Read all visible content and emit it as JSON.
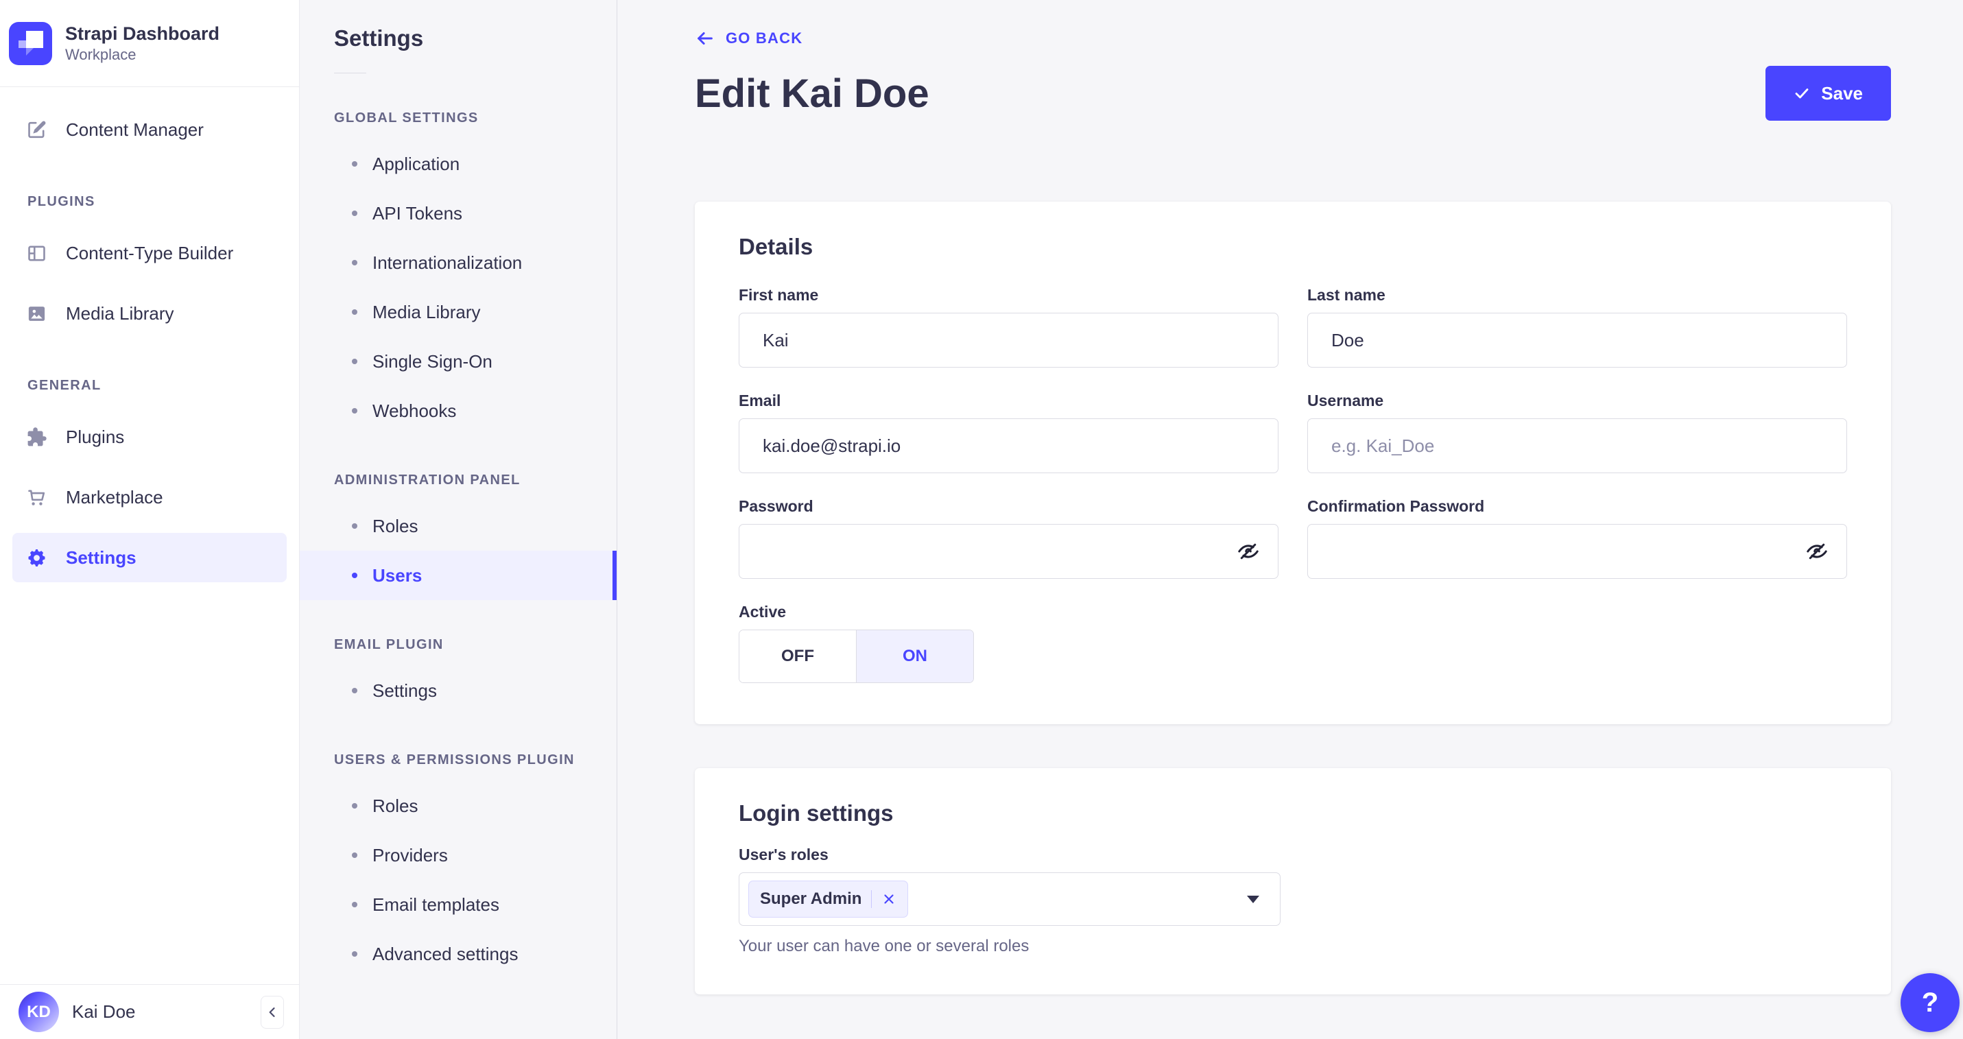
{
  "app": {
    "brand_title": "Strapi Dashboard",
    "brand_subtitle": "Workplace"
  },
  "colors": {
    "primary": "#4945ff",
    "primary_light": "#f0f0ff",
    "text": "#32324d",
    "muted": "#666687",
    "icon": "#8e8ea9",
    "border": "#dcdce4",
    "surface": "#ffffff",
    "background": "#f6f6f9"
  },
  "icons": {
    "logo": "strapi-logo",
    "content_manager": "feather-icon",
    "content_type_builder": "layout-icon",
    "media_library": "picture-icon",
    "plugins": "puzzle-icon",
    "marketplace": "cart-icon",
    "settings": "gear-icon",
    "collapse": "chevron-left-icon",
    "go_back": "arrow-left-icon",
    "save": "check-icon",
    "password_visibility": "eye-slash-icon",
    "roles_select": "caret-down-icon",
    "tag_remove": "x-icon",
    "help": "question-icon"
  },
  "nav": {
    "content_manager": "Content Manager",
    "sections": [
      {
        "label": "PLUGINS",
        "items": [
          "Content-Type Builder",
          "Media Library"
        ]
      },
      {
        "label": "GENERAL",
        "items": [
          "Plugins",
          "Marketplace",
          "Settings"
        ]
      }
    ],
    "active_item": "Settings",
    "user": {
      "initials": "KD",
      "name": "Kai Doe"
    }
  },
  "settings_nav": {
    "title": "Settings",
    "sections": [
      {
        "label": "GLOBAL SETTINGS",
        "items": [
          "Application",
          "API Tokens",
          "Internationalization",
          "Media Library",
          "Single Sign-On",
          "Webhooks"
        ]
      },
      {
        "label": "ADMINISTRATION PANEL",
        "items": [
          "Roles",
          "Users"
        ],
        "active_item": "Users"
      },
      {
        "label": "EMAIL PLUGIN",
        "items": [
          "Settings"
        ]
      },
      {
        "label": "USERS & PERMISSIONS PLUGIN",
        "items": [
          "Roles",
          "Providers",
          "Email templates",
          "Advanced settings"
        ]
      }
    ]
  },
  "header": {
    "go_back": "GO BACK",
    "title": "Edit Kai Doe",
    "save": "Save"
  },
  "details": {
    "heading": "Details",
    "first_name": {
      "label": "First name",
      "value": "Kai"
    },
    "last_name": {
      "label": "Last name",
      "value": "Doe"
    },
    "email": {
      "label": "Email",
      "value": "kai.doe@strapi.io"
    },
    "username": {
      "label": "Username",
      "placeholder": "e.g. Kai_Doe"
    },
    "password": {
      "label": "Password",
      "value": ""
    },
    "confirmation_password": {
      "label": "Confirmation Password",
      "value": ""
    },
    "active": {
      "label": "Active",
      "off": "OFF",
      "on": "ON",
      "selected": "ON"
    }
  },
  "login_settings": {
    "heading": "Login settings",
    "roles_label": "User's roles",
    "selected_roles": [
      "Super Admin"
    ],
    "hint": "Your user can have one or several roles"
  },
  "help": {
    "label": "?"
  }
}
